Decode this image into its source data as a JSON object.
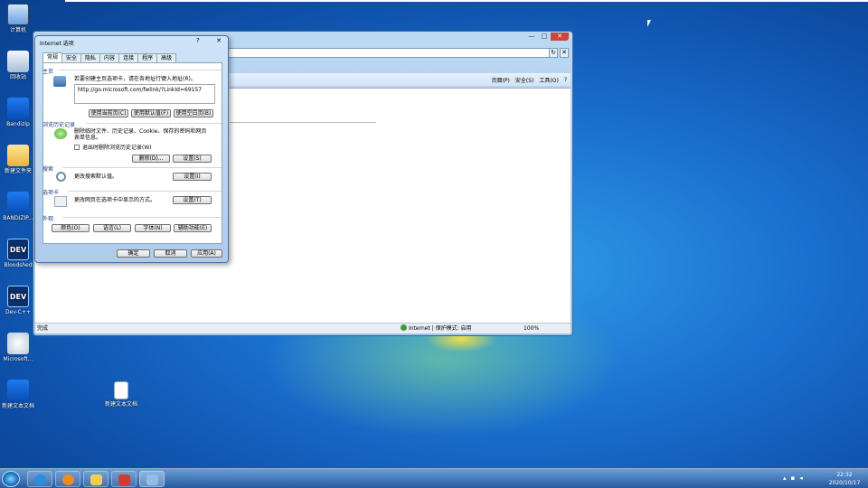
{
  "desktop": {
    "icons": [
      {
        "label": "计算机"
      },
      {
        "label": "回收站"
      },
      {
        "label": "Bandizip"
      },
      {
        "label": "新建文件夹"
      },
      {
        "label": "BANDIZIP..."
      },
      {
        "label": "Bloodshed"
      },
      {
        "label": "Dev-C++"
      },
      {
        "label": "Microsoft..."
      },
      {
        "label": "新建文本文档"
      },
      {
        "label": "新建文本文档"
      }
    ]
  },
  "ie_window": {
    "minimize": "—",
    "maximize": "□",
    "close": "✕",
    "addr_buttons": [
      "↻",
      "✕"
    ],
    "commands": [
      "页面(P)",
      "安全(S)",
      "工具(O)",
      "?"
    ],
    "status_text": "完成",
    "zone_text": "Internet | 保护模式: 启用",
    "zoom_text": "100%"
  },
  "dialog": {
    "title": "Internet 选项",
    "help": "?",
    "close": "✕",
    "tabs": [
      "常规",
      "安全",
      "隐私",
      "内容",
      "连接",
      "程序",
      "高级"
    ],
    "home": {
      "section": "主页",
      "desc": "若要创建主页选项卡，请在各地址行键入地址(R)。",
      "url": "http://go.microsoft.com/fwlink/?LinkId=69157",
      "btn_current": "使用当前页(C)",
      "btn_default": "使用默认值(F)",
      "btn_blank": "使用空白页(B)"
    },
    "history": {
      "section": "浏览历史记录",
      "desc": "删除临时文件、历史记录、Cookie、保存的密码和网页表单信息。",
      "checkbox": "退出时删除浏览历史记录(W)",
      "btn_delete": "删除(D)...",
      "btn_settings": "设置(S)"
    },
    "search": {
      "section": "搜索",
      "desc": "更改搜索默认值。",
      "btn_settings": "设置(I)"
    },
    "tabsec": {
      "section": "选项卡",
      "desc": "更改网页在选项卡中显示的方式。",
      "btn_settings": "设置(T)"
    },
    "appearance": {
      "section": "外观",
      "btn_colors": "颜色(O)",
      "btn_languages": "语言(L)",
      "btn_fonts": "字体(N)",
      "btn_accessibility": "辅助功能(E)"
    },
    "footer": {
      "ok": "确定",
      "cancel": "取消",
      "apply": "应用(A)"
    }
  },
  "taskbar": {
    "time": "22:32",
    "date": "2020/10/17"
  }
}
